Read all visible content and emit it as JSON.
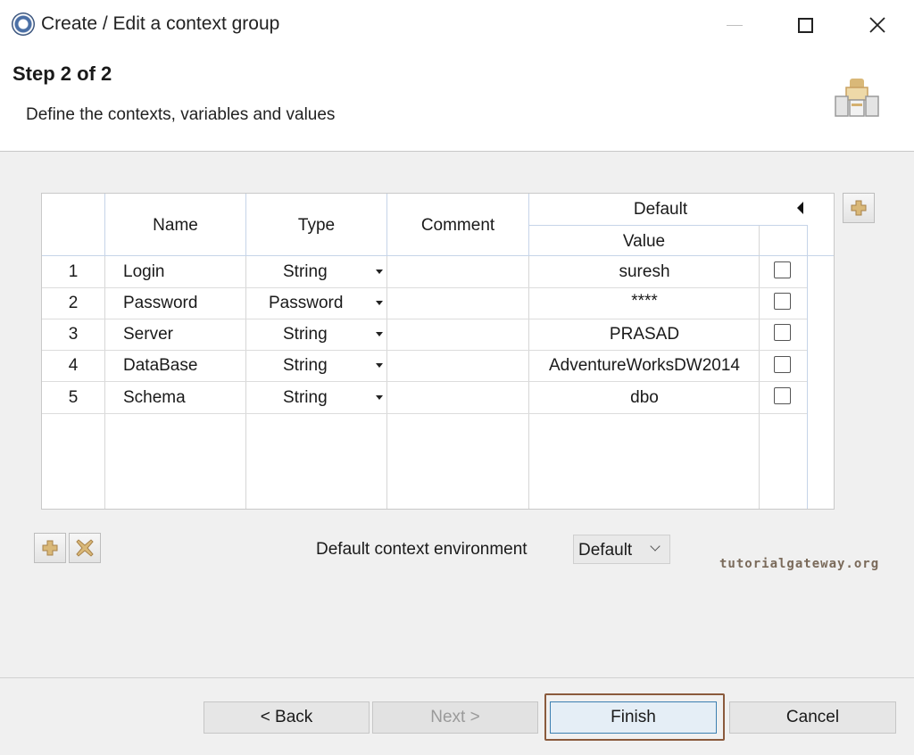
{
  "window": {
    "title": "Create / Edit a context group"
  },
  "header": {
    "step_title": "Step 2 of 2",
    "description": "Define the contexts, variables and values"
  },
  "table": {
    "headers": {
      "number": "",
      "name": "Name",
      "type": "Type",
      "comment": "Comment",
      "group": "Default",
      "value": "Value"
    },
    "rows": [
      {
        "num": "1",
        "name": "Login",
        "type": "String",
        "comment": "",
        "value": "suresh",
        "checked": false
      },
      {
        "num": "2",
        "name": "Password",
        "type": "Password",
        "comment": "",
        "value": "****",
        "checked": false
      },
      {
        "num": "3",
        "name": "Server",
        "type": "String",
        "comment": "",
        "value": "PRASAD",
        "checked": false
      },
      {
        "num": "4",
        "name": "DataBase",
        "type": "String",
        "comment": "",
        "value": "AdventureWorksDW2014",
        "checked": false
      },
      {
        "num": "5",
        "name": "Schema",
        "type": "String",
        "comment": "",
        "value": "dbo",
        "checked": false
      }
    ]
  },
  "context_env": {
    "label": "Default context environment",
    "selected": "Default"
  },
  "watermark": "tutorialgateway.org",
  "buttons": {
    "back": "< Back",
    "next": "Next >",
    "finish": "Finish",
    "cancel": "Cancel"
  },
  "icons": {
    "add_context": "plus-icon",
    "add_row": "plus-icon",
    "remove_row": "cross-icon",
    "wizard": "wizard-icon"
  },
  "colors": {
    "finish_highlight": "#8a5a3c",
    "header_line": "#c6d4e8",
    "icon_accent": "#c8a060"
  }
}
